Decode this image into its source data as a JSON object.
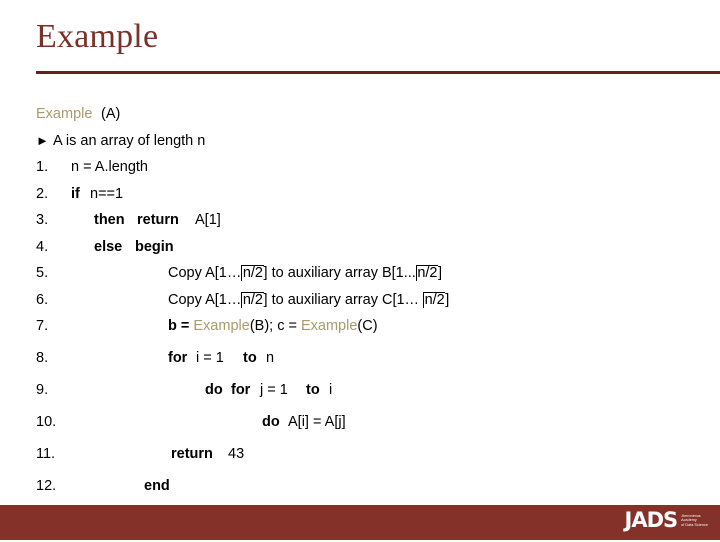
{
  "slide": {
    "title": "Example",
    "accent_color": "#7B3029",
    "rule_color": "#5B2620",
    "footer_color": "#84312A",
    "call_color": "#A99A6C"
  },
  "code": {
    "signature": {
      "name": "Example",
      "args": "(A)"
    },
    "note": {
      "bullet": "►",
      "text": "A is an array of length n"
    },
    "lines": [
      {
        "num": "1.",
        "text": "n = A.length"
      },
      {
        "num": "2.",
        "kw1": "if",
        "text": "n==1"
      },
      {
        "num": "3.",
        "kw1": "then",
        "kw2": "return",
        "text": "A[1]"
      },
      {
        "num": "4.",
        "kw1": "else",
        "kw2": "begin",
        "text": ""
      },
      {
        "num": "5.",
        "pre": "Copy A[1…",
        "c1": "n/2",
        "mid": "] to auxiliary array B[1...",
        "c2": "n/2",
        "post": "]"
      },
      {
        "num": "6.",
        "pre": "Copy A[1…",
        "c1": "n/2",
        "mid": "] to auxiliary array C[1… ",
        "c2": "n/2",
        "post": "]"
      },
      {
        "num": "7.",
        "pre": "b = ",
        "call1": "Example",
        "mid": "(B); c = ",
        "call2": "Example",
        "post": "(C)"
      },
      {
        "num": "8.",
        "kw1": "for",
        "t1": "i = 1",
        "kw2": "to",
        "t2": "n"
      },
      {
        "num": "9.",
        "kw0": "do",
        "kw1": "for",
        "t1": "j = 1",
        "kw2": "to",
        "t2": "i"
      },
      {
        "num": "10.",
        "kw1": "do",
        "text": "A[i] = A[j]"
      },
      {
        "num": "11.",
        "kw1": "return",
        "text": "43"
      },
      {
        "num": "12.",
        "kw1": "end",
        "text": ""
      }
    ]
  },
  "footer": {
    "logo_text": "JADS",
    "tagline_line1": "Jheronimus",
    "tagline_line2": "Academy",
    "tagline_line3": "of Data Science"
  }
}
